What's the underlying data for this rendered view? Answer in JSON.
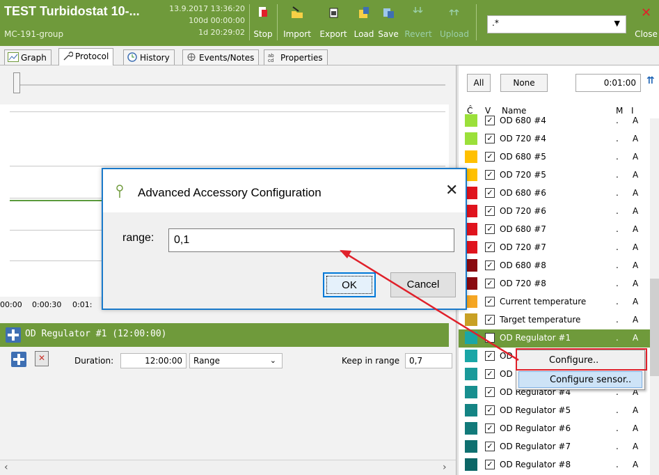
{
  "toolbar": {
    "title": "TEST Turbidostat 10-...",
    "group": "MC-191-group",
    "date": "13.9.2017 13:36:20",
    "elapsed": "100d 00:00:00",
    "remaining": "1d 20:29:02",
    "buttons": {
      "stop": "Stop",
      "import": "Import",
      "export": "Export",
      "load": "Load",
      "save": "Save",
      "revert": "Revert",
      "upload": "Upload",
      "close": "Close"
    },
    "filter_value": ".*"
  },
  "tabs": {
    "graph": "Graph",
    "protocol": "Protocol",
    "history": "History",
    "events": "Events/Notes",
    "properties": "Properties"
  },
  "time_axis": [
    "00:00",
    "0:00:30",
    "0:01:"
  ],
  "regulator": {
    "title": "OD Regulator #1 (12:00:00)",
    "duration_label": "Duration:",
    "duration_value": "12:00:00",
    "mode_value": "Range",
    "keep_label": "Keep in range",
    "keep_value": "0,7"
  },
  "right_panel": {
    "all_label": "All",
    "none_label": "None",
    "time_value": "0:01:00",
    "columns": {
      "c": "Ĉ",
      "v": "V",
      "name": "Name",
      "m": "M",
      "i": "I"
    },
    "sensors": [
      {
        "name": "OD 680 #4",
        "color": "#9be03a",
        "m": ".",
        "i": "A"
      },
      {
        "name": "OD 720 #4",
        "color": "#9be03a",
        "m": ".",
        "i": "A"
      },
      {
        "name": "OD 680 #5",
        "color": "#ffc000",
        "m": ".",
        "i": "A"
      },
      {
        "name": "OD 720 #5",
        "color": "#ffc000",
        "m": ".",
        "i": "A"
      },
      {
        "name": "OD 680 #6",
        "color": "#e0141e",
        "m": ".",
        "i": "A"
      },
      {
        "name": "OD 720 #6",
        "color": "#e0141e",
        "m": ".",
        "i": "A"
      },
      {
        "name": "OD 680 #7",
        "color": "#e0141e",
        "m": ".",
        "i": "A"
      },
      {
        "name": "OD 720 #7",
        "color": "#e0141e",
        "m": ".",
        "i": "A"
      },
      {
        "name": "OD 680 #8",
        "color": "#8a0a10",
        "m": ".",
        "i": "A"
      },
      {
        "name": "OD 720 #8",
        "color": "#8a0a10",
        "m": ".",
        "i": "A"
      },
      {
        "name": "Current temperature",
        "color": "#f5a623",
        "m": ".",
        "i": "A"
      },
      {
        "name": "Target temperature",
        "color": "#c8a024",
        "m": ".",
        "i": "A"
      },
      {
        "name": "OD Regulator #1",
        "color": "#1aa6a6",
        "m": ".",
        "i": "A"
      },
      {
        "name": "OD",
        "color": "#1aa6a6",
        "m": ".",
        "i": "A"
      },
      {
        "name": "OD",
        "color": "#1a9a9a",
        "m": ".",
        "i": "A"
      },
      {
        "name": "OD Regulator #4",
        "color": "#178f8f",
        "m": ".",
        "i": "A"
      },
      {
        "name": "OD Regulator #5",
        "color": "#148484",
        "m": ".",
        "i": "A"
      },
      {
        "name": "OD Regulator #6",
        "color": "#127a7a",
        "m": ".",
        "i": "A"
      },
      {
        "name": "OD Regulator #7",
        "color": "#0f7070",
        "m": ".",
        "i": "A"
      },
      {
        "name": "OD Regulator #8",
        "color": "#0c6666",
        "m": ".",
        "i": "A"
      }
    ]
  },
  "context_menu": {
    "configure": "Configure..",
    "configure_sensor": "Configure sensor.."
  },
  "dialog": {
    "title": "Advanced Accessory Configuration",
    "range_label": "range:",
    "range_value": "0,1",
    "ok": "OK",
    "cancel": "Cancel"
  },
  "colors": {
    "toolbar_green": "#6f9a3b",
    "selection_green": "#6f9a3b",
    "dialog_border": "#1979ca",
    "annotation_red": "#e0202a"
  }
}
